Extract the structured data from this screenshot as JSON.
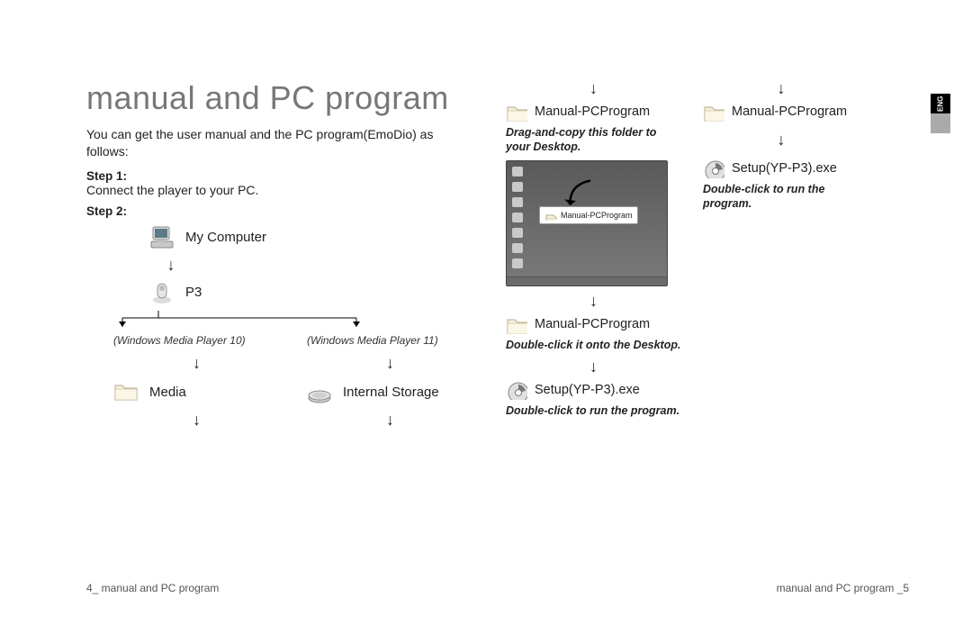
{
  "title": "manual and PC program",
  "intro": "You can get the user manual and the PC program(EmoDio) as follows:",
  "steps": {
    "s1_label": "Step 1:",
    "s1_text": "Connect the player to your PC.",
    "s2_label": "Step 2:"
  },
  "tree": {
    "my_computer": "My Computer",
    "device": "P3",
    "wmp10": "(Windows Media Player 10)",
    "wmp11": "(Windows Media Player 11)",
    "media": "Media",
    "internal": "Internal Storage"
  },
  "mid": {
    "folder1": "Manual-PCProgram",
    "drag_copy": "Drag-and-copy this folder to your Desktop.",
    "drag_label": "Manual-PCProgram",
    "folder2": "Manual-PCProgram",
    "dbl_desktop": "Double-click it onto the Desktop.",
    "setup": "Setup(YP-P3).exe",
    "dbl_run": "Double-click to run the program."
  },
  "far": {
    "folder": "Manual-PCProgram",
    "setup": "Setup(YP-P3).exe",
    "dbl_run": "Double-click to run the program."
  },
  "lang": "ENG",
  "footer_left": "4_ manual and PC program",
  "footer_right": "manual and PC program _5"
}
